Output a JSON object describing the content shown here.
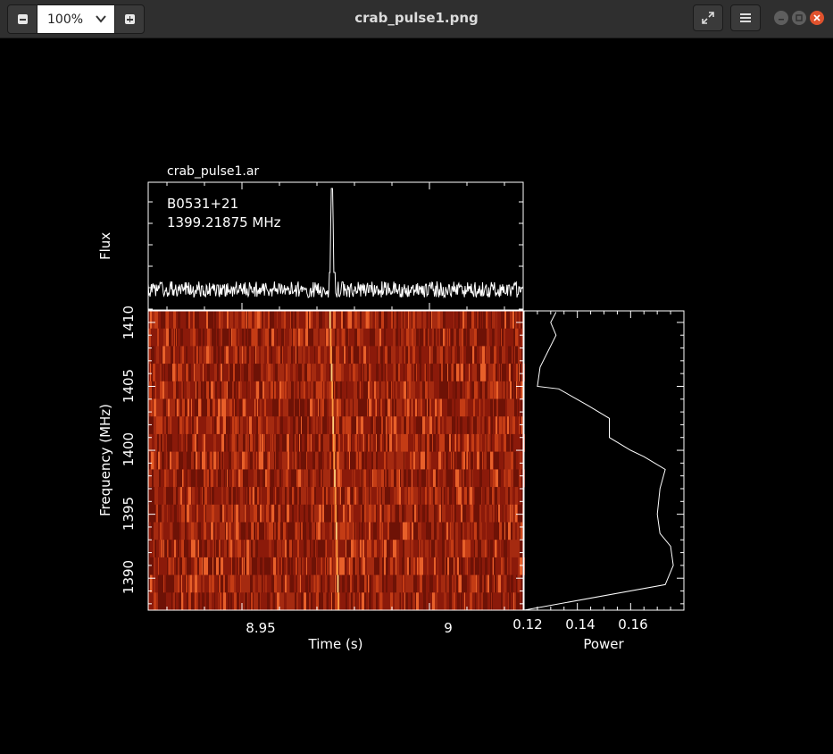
{
  "window": {
    "title": "crab_pulse1.png",
    "zoom_value": "100%"
  },
  "colors": {
    "titlebar_bg": "#2f2f2f",
    "close_button": "#e0522d",
    "plot_background": "#000000",
    "plot_foreground": "#ffffff",
    "waterfall_base": "#8b1a0a",
    "waterfall_bright": "#ff9a40"
  },
  "icons": [
    "zoom-out-icon",
    "chevron-down-icon",
    "zoom-in-icon",
    "fullscreen-icon",
    "hamburger-menu-icon",
    "minimize-icon",
    "maximize-icon",
    "close-icon"
  ],
  "plot": {
    "archive_name": "crab_pulse1.ar",
    "source_name": "B0531+21",
    "frequency_label": "1399.21875 MHz",
    "flux_label": "Flux",
    "freq_axis_label": "Frequency (MHz)",
    "time_axis_label": "Time (s)",
    "power_axis_label": "Power",
    "time_ticks": [
      "8.95",
      "9"
    ],
    "freq_ticks": [
      "1410",
      "1405",
      "1400",
      "1395",
      "1390"
    ],
    "power_ticks": [
      "0.12",
      "0.14",
      "0.16"
    ]
  },
  "chart_data": [
    {
      "type": "line",
      "panel": "pulse-profile",
      "ylabel": "Flux",
      "xlim": [
        8.925,
        9.025
      ],
      "x_ticks": [
        8.95,
        9
      ],
      "pulse_peak_time": 8.974,
      "annotations": [
        "B0531+21",
        "1399.21875 MHz"
      ]
    },
    {
      "type": "heatmap",
      "panel": "dynamic-spectrum",
      "xlabel": "Time (s)",
      "ylabel": "Frequency (MHz)",
      "xlim": [
        8.925,
        9.025
      ],
      "ylim": [
        1387.5,
        1410.9
      ],
      "x_ticks": [
        8.95,
        9
      ],
      "y_ticks": [
        1410,
        1405,
        1400,
        1395,
        1390
      ],
      "pulse_time": 8.974
    },
    {
      "type": "line",
      "panel": "power-spectrum",
      "xlabel": "Power",
      "xlim": [
        0.12,
        0.18
      ],
      "x_ticks": [
        0.12,
        0.14,
        0.16
      ],
      "ylim": [
        1387.5,
        1410.9
      ],
      "x": [
        0.132,
        0.13,
        0.132,
        0.126,
        0.125,
        0.133,
        0.144,
        0.152,
        0.152,
        0.16,
        0.165,
        0.173,
        0.171,
        0.17,
        0.171,
        0.175,
        0.176,
        0.173,
        0.12
      ],
      "y": [
        1410.8,
        1410.0,
        1409.0,
        1406.5,
        1405.0,
        1404.8,
        1403.5,
        1402.5,
        1401.0,
        1400.0,
        1399.5,
        1398.5,
        1397.0,
        1395.0,
        1393.5,
        1392.5,
        1391.0,
        1389.5,
        1387.5
      ]
    }
  ]
}
